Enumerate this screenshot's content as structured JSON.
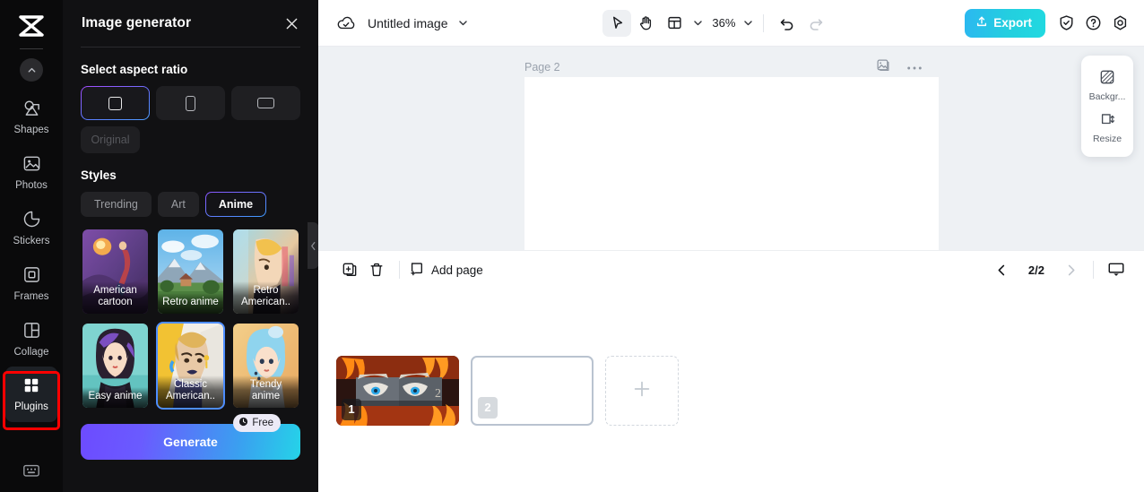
{
  "rail": {
    "logo_icon": "capcut-logo-icon",
    "collapse_icon": "chevron-up-icon",
    "items": [
      {
        "label": "Shapes",
        "icon": "shapes-icon"
      },
      {
        "label": "Photos",
        "icon": "photo-icon"
      },
      {
        "label": "Stickers",
        "icon": "sticker-icon"
      },
      {
        "label": "Frames",
        "icon": "frame-icon"
      },
      {
        "label": "Collage",
        "icon": "collage-icon"
      },
      {
        "label": "Plugins",
        "icon": "plugins-icon"
      }
    ],
    "active_item": "Plugins",
    "highlight_color": "#ff0000",
    "keyboard_icon": "keyboard-icon"
  },
  "panel": {
    "title": "Image generator",
    "close_icon": "close-icon",
    "aspect_section_title": "Select aspect ratio",
    "aspect_options": [
      {
        "name": "square",
        "icon": "square-icon",
        "selected": true
      },
      {
        "name": "portrait",
        "icon": "portrait-icon",
        "selected": false
      },
      {
        "name": "landscape",
        "icon": "landscape-icon",
        "selected": false
      }
    ],
    "original_label": "Original",
    "styles_section_title": "Styles",
    "style_tabs": [
      {
        "label": "Trending",
        "selected": false
      },
      {
        "label": "Art",
        "selected": false
      },
      {
        "label": "Anime",
        "selected": true
      }
    ],
    "style_cards": [
      {
        "label": "American cartoon",
        "selected": false
      },
      {
        "label": "Retro anime",
        "selected": false
      },
      {
        "label": "Retro American..",
        "selected": false
      },
      {
        "label": "Easy anime",
        "selected": false
      },
      {
        "label": "Classic American..",
        "selected": true
      },
      {
        "label": "Trendy anime",
        "selected": false
      }
    ],
    "generate_label": "Generate",
    "free_badge": "Free",
    "free_badge_icon": "clock-icon",
    "collapse_handle_icon": "chevron-left-icon",
    "accent_gradient_start": "#6d4bff",
    "accent_gradient_end": "#25d3e8"
  },
  "topbar": {
    "cloud_icon": "cloud-saved-icon",
    "doc_title": "Untitled image",
    "title_caret_icon": "chevron-down-icon",
    "select_tool_icon": "cursor-select-icon",
    "hand_tool_icon": "hand-pan-icon",
    "layout_tool_icon": "layout-grid-icon",
    "layout_caret_icon": "chevron-down-icon",
    "zoom_value": "36%",
    "zoom_caret_icon": "chevron-down-icon",
    "undo_icon": "undo-icon",
    "redo_icon": "redo-icon",
    "export_label": "Export",
    "export_icon": "upload-icon",
    "export_color": "#23cfdf",
    "shield_icon": "shield-check-icon",
    "help_icon": "question-circle-icon",
    "settings_icon": "gear-icon"
  },
  "canvas": {
    "page_label": "Page 2",
    "duplicate_icon": "duplicate-page-icon",
    "more_icon": "more-horizontal-icon",
    "background_color": "#eef1f4",
    "float_tools": [
      {
        "label": "Backgr...",
        "icon": "background-icon"
      },
      {
        "label": "Resize",
        "icon": "resize-icon"
      }
    ]
  },
  "pagebar": {
    "duplicate_icon": "duplicate-icon",
    "delete_icon": "trash-icon",
    "add_page_label": "Add page",
    "add_page_icon": "add-page-icon",
    "prev_icon": "chevron-left-icon",
    "page_counter": "2/2",
    "next_icon": "chevron-right-icon",
    "present_icon": "present-icon"
  },
  "filmstrip": {
    "thumbs": [
      {
        "number": "1",
        "selected": false,
        "kind": "image"
      },
      {
        "number": "2",
        "selected": true,
        "kind": "blank"
      }
    ],
    "add_icon": "plus-icon"
  }
}
